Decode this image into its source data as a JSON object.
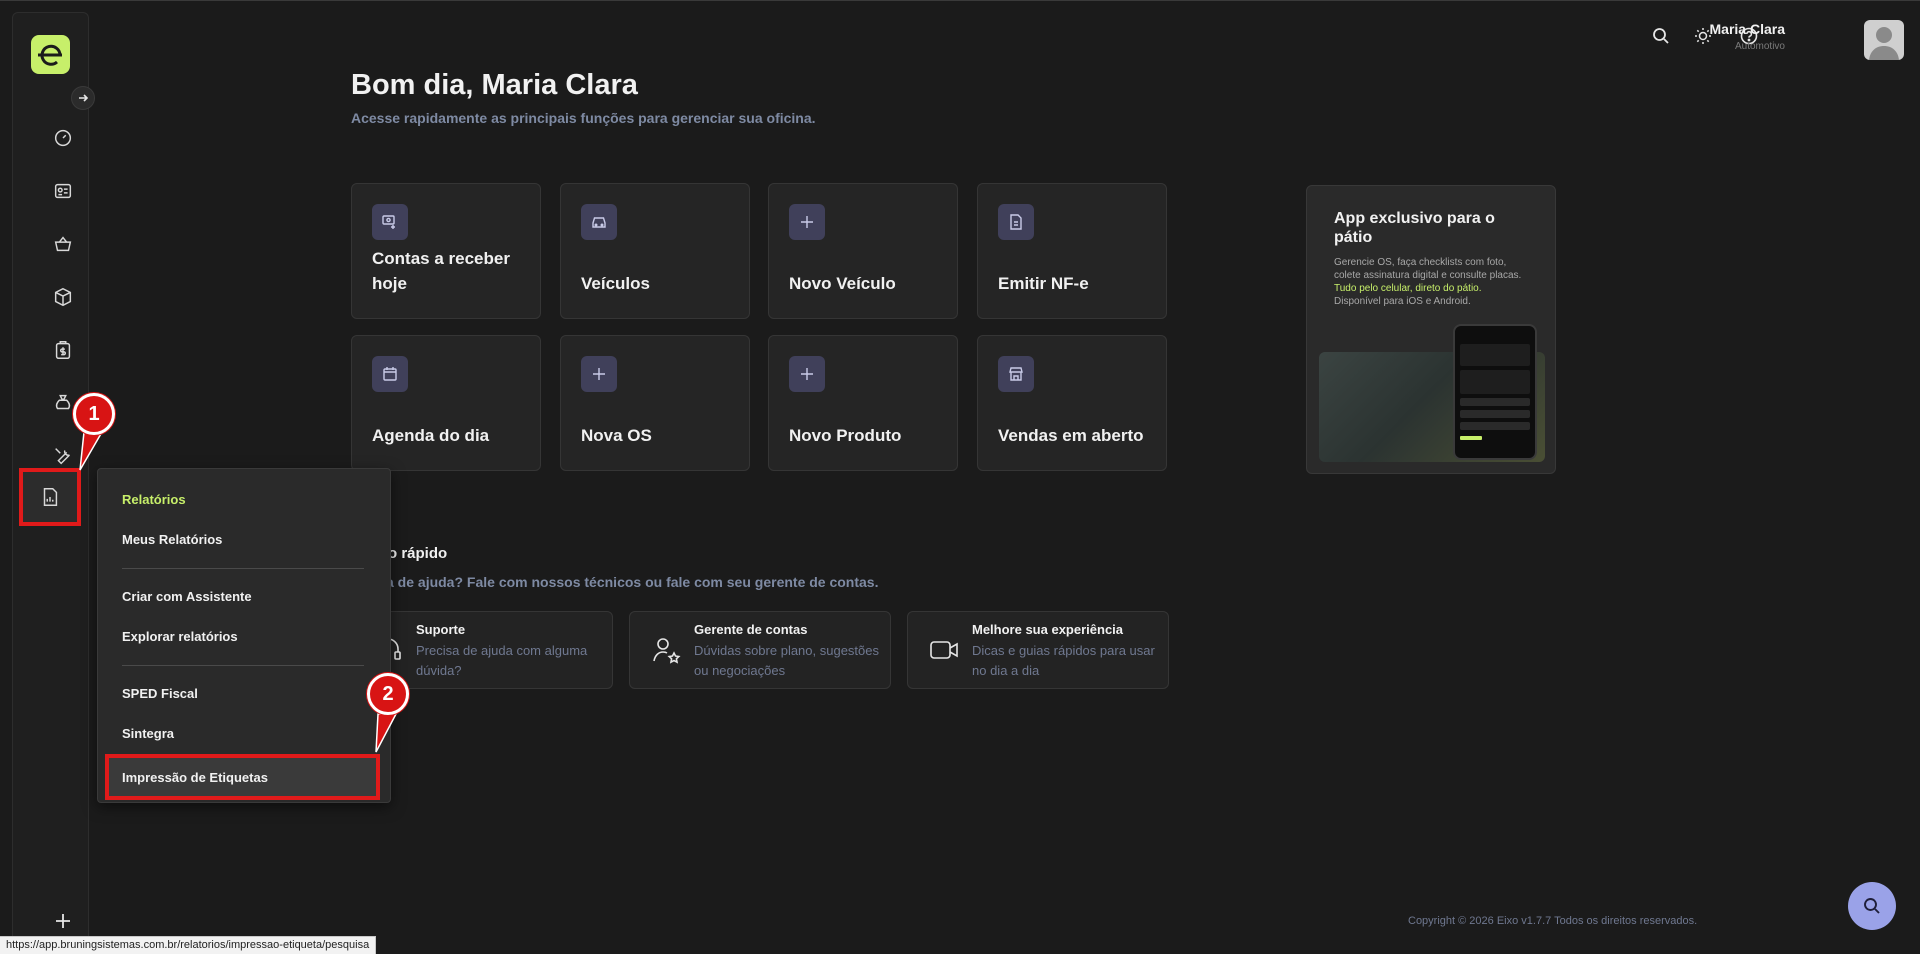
{
  "header": {
    "user_name": "Maria Clara",
    "user_role": "Automotivo"
  },
  "greeting": {
    "title": "Bom dia, Maria Clara",
    "subtitle": "Acesse rapidamente as principais funções para gerenciar sua oficina."
  },
  "cards": [
    {
      "label": "Contas a receber hoje",
      "icon": "money-receive-icon"
    },
    {
      "label": "Veículos",
      "icon": "car-icon"
    },
    {
      "label": "Novo Veículo",
      "icon": "plus-icon"
    },
    {
      "label": "Emitir NF-e",
      "icon": "invoice-icon"
    },
    {
      "label": "Agenda do dia",
      "icon": "calendar-icon"
    },
    {
      "label": "Nova OS",
      "icon": "plus-icon"
    },
    {
      "label": "Novo Produto",
      "icon": "plus-icon"
    },
    {
      "label": "Vendas em aberto",
      "icon": "store-icon"
    }
  ],
  "promo": {
    "title": "App exclusivo para o pátio",
    "text_before": "Gerencie OS, faça checklists com foto, colete assinatura digital e consulte placas. ",
    "text_highlight": "Tudo pelo celular, direto do pátio.",
    "text_after": " Disponível para iOS e Android."
  },
  "contact_section": {
    "title": "o rápido",
    "subtitle": "a de ajuda? Fale com nossos técnicos ou fale com seu gerente de contas.",
    "items": [
      {
        "title": "Suporte",
        "desc": "Precisa de ajuda com alguma dúvida?"
      },
      {
        "title": "Gerente de contas",
        "desc": "Dúvidas sobre plano, sugestões ou negociações"
      },
      {
        "title": "Melhore sua experiência",
        "desc": "Dicas e guias rápidos para usar no dia a dia"
      }
    ]
  },
  "menu": {
    "header": "Relatórios",
    "items": [
      "Meus Relatórios",
      "Criar com Assistente",
      "Explorar relatórios",
      "SPED Fiscal",
      "Sintegra",
      "Impressão de Etiquetas"
    ]
  },
  "callouts": [
    "1",
    "2"
  ],
  "footer": "Copyright © 2026 Eixo v1.7.7 Todos os direitos reservados.",
  "status_url": "https://app.bruningsistemas.com.br/relatorios/impressao-etiqueta/pesquisa",
  "colors": {
    "background": "#1b1b1b",
    "accent_green": "#c7ef6a",
    "callout_red": "#e01a1a",
    "fab": "#9aa2e8"
  }
}
